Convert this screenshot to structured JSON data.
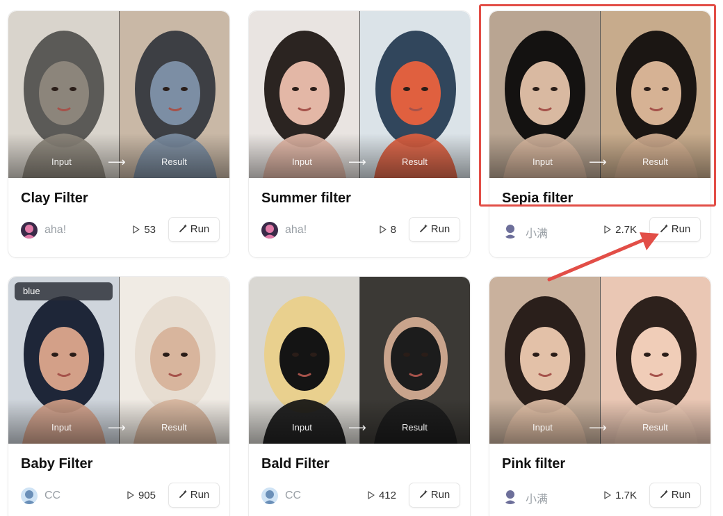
{
  "cards": [
    {
      "title": "Clay Filter",
      "author": "aha!",
      "plays": "53",
      "run_label": "Run",
      "input_label": "Input",
      "result_label": "Result",
      "avatar_colors": [
        "#3a2a48",
        "#e17aa8"
      ],
      "left_colors": [
        "#d9d4cc",
        "#5b5a57",
        "#8c857b"
      ],
      "right_colors": [
        "#c9b8a6",
        "#3d3f44",
        "#7c8ea4"
      ]
    },
    {
      "title": "Summer filter",
      "author": "aha!",
      "plays": "8",
      "run_label": "Run",
      "input_label": "Input",
      "result_label": "Result",
      "avatar_colors": [
        "#3a2a48",
        "#e17aa8"
      ],
      "left_colors": [
        "#e9e4e1",
        "#2b2421",
        "#e3b7a6"
      ],
      "right_colors": [
        "#dbe3e8",
        "#31465c",
        "#e0603f"
      ]
    },
    {
      "title": "Sepia filter",
      "author": "小满",
      "plays": "2.7K",
      "run_label": "Run",
      "input_label": "Input",
      "result_label": "Result",
      "avatar_colors": [
        "#ffffff",
        "#6d6f9a"
      ],
      "left_colors": [
        "#b9a592",
        "#141211",
        "#d9b9a1"
      ],
      "right_colors": [
        "#c7ab8c",
        "#1b1613",
        "#d6b294"
      ]
    },
    {
      "title": "Baby Filter",
      "author": "CC",
      "plays": "905",
      "run_label": "Run",
      "input_label": "Input",
      "result_label": "Result",
      "badge": "blue",
      "avatar_colors": [
        "#cfe3f5",
        "#6a8fb8"
      ],
      "left_colors": [
        "#cfd5dc",
        "#1e2638",
        "#d3a088"
      ],
      "right_colors": [
        "#f0ebe4",
        "#e7ddd1",
        "#d8b59d"
      ]
    },
    {
      "title": "Bald Filter",
      "author": "CC",
      "plays": "412",
      "run_label": "Run",
      "input_label": "Input",
      "result_label": "Result",
      "avatar_colors": [
        "#cfe3f5",
        "#6a8fb8"
      ],
      "left_colors": [
        "#d9d7d2",
        "#e9d08e",
        "#141414"
      ],
      "right_colors": [
        "#3b3935",
        "#c9a48c",
        "#1c1c1c"
      ]
    },
    {
      "title": "Pink filter",
      "author": "小满",
      "plays": "1.7K",
      "run_label": "Run",
      "input_label": "Input",
      "result_label": "Result",
      "avatar_colors": [
        "#ffffff",
        "#6d6f9a"
      ],
      "left_colors": [
        "#c9b19d",
        "#2a1f1b",
        "#e3c1a8"
      ],
      "right_colors": [
        "#eac7b4",
        "#2d211c",
        "#f0cdb8"
      ]
    }
  ],
  "annotation": {
    "highlight_color": "#e24e47"
  }
}
